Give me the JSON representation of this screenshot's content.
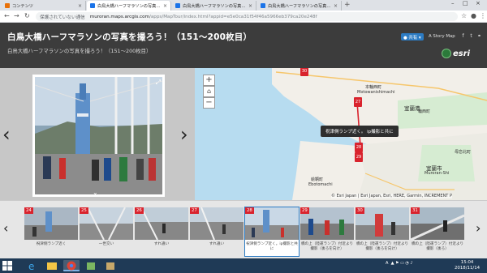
{
  "browser": {
    "tabs": [
      {
        "label": "コンテンツ",
        "favicon": "orange",
        "active": false
      },
      {
        "label": "白鳥大橋ハーフマラソンの写真を撮ろう！",
        "favicon": "blue",
        "active": true
      },
      {
        "label": "白鳥大橋ハーフマラソンの写真を撮ろう！",
        "favicon": "blue",
        "active": false
      },
      {
        "label": "白鳥大橋ハーフマラソンの写真を撮ろう！",
        "favicon": "blue",
        "active": false
      }
    ],
    "new_tab": "+",
    "address": {
      "security": "保護されていない通信",
      "host": "muroran.maps.arcgis.com",
      "path": "/apps/MapTour/index.html?appid=e5e0ca31f54f46a5966eb379ca20e248f"
    }
  },
  "story": {
    "title": "白鳥大橋ハーフマラソンの写真を撮ろう！（151〜200枚目）",
    "subtitle": "白鳥大橋ハーフマラソンの写真を撮ろう！（151〜200枚目）",
    "share_label": "● 共有 ▾",
    "story_link": "A Story Map",
    "brand": "esri"
  },
  "media": {
    "prev_label": "‹",
    "next_label": "›"
  },
  "map": {
    "zoom_in": "+",
    "home": "⌂",
    "zoom_out": "−",
    "tooltip": "祝津側ランプ近く。 ip撮影と共に",
    "attribution": "© Esri Japan | Esri Japan, Esri, HERE, Garmin, INCREMENT P",
    "labels": [
      {
        "text": "室蘭港",
        "cls": "big"
      },
      {
        "text": "絵鞆町",
        "cls": ""
      },
      {
        "text": "Ebotomachi",
        "cls": ""
      },
      {
        "text": "室蘭市",
        "cls": "big"
      },
      {
        "text": "Muroran-Shi",
        "cls": ""
      },
      {
        "text": "本輪西町",
        "cls": ""
      },
      {
        "text": "Motowanishimachi",
        "cls": ""
      },
      {
        "text": "輪西町",
        "cls": ""
      },
      {
        "text": "母恋北町",
        "cls": ""
      }
    ],
    "markers": [
      "27",
      "28",
      "29",
      "30"
    ]
  },
  "carousel": {
    "prev_label": "‹",
    "next_label": "›",
    "items": [
      {
        "num": "24",
        "caption": "祝津側ランプ近く"
      },
      {
        "num": "25",
        "caption": "一世交い"
      },
      {
        "num": "26",
        "caption": "すれ違い"
      },
      {
        "num": "27",
        "caption": "すれ違い"
      },
      {
        "num": "28",
        "caption": "祝津側ランプ近く。ip撮影と共に"
      },
      {
        "num": "29",
        "caption": "橋の上（陸運ランプ）付近より撮影（後ろを向け）"
      },
      {
        "num": "30",
        "caption": "橋の上（陸運ランプ）付近より撮影（後ろを向け）"
      },
      {
        "num": "31",
        "caption": "橋の上（陸運ランプ）付近より撮影（後ろ）"
      }
    ]
  },
  "taskbar": {
    "time": "15:04",
    "date": "2018/11/14",
    "ime": "A"
  },
  "colors": {
    "header_bg": "#3c3c3c",
    "accent": "#2c7bc3",
    "marker": "#d9232d",
    "water": "#b7dcf0",
    "land": "#f2efe9",
    "taskbar": "#1f3a56"
  }
}
